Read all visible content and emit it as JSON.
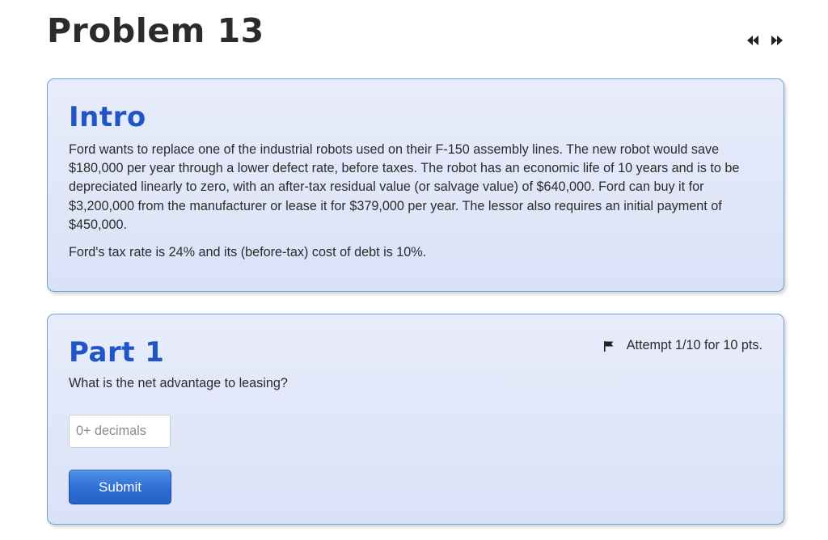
{
  "header": {
    "title": "Problem 13",
    "prev_icon": "double-left-arrow",
    "next_icon": "double-right-arrow"
  },
  "intro": {
    "heading": "Intro",
    "paragraph_1": "Ford wants to replace one of the industrial robots used on their F-150 assembly lines. The new robot would save $180,000 per year through a lower defect rate, before taxes. The robot has an economic life of 10 years and is to be depreciated linearly to zero, with an after-tax residual value (or salvage value) of $640,000. Ford can buy it for $3,200,000 from the manufacturer or lease it for $379,000 per year. The lessor also requires an initial payment of $450,000.",
    "paragraph_2": "Ford's tax rate is 24% and its (before-tax) cost of debt is 10%."
  },
  "part": {
    "heading": "Part 1",
    "attempt_text": "Attempt 1/10 for 10 pts.",
    "flag_icon": "flag",
    "question": "What is the net advantage to leasing?",
    "input_placeholder": "0+ decimals",
    "input_value": "",
    "submit_label": "Submit"
  },
  "colors": {
    "heading_blue": "#1f55c9",
    "card_border": "#6fa2d6",
    "button_blue": "#2f6fd6"
  }
}
